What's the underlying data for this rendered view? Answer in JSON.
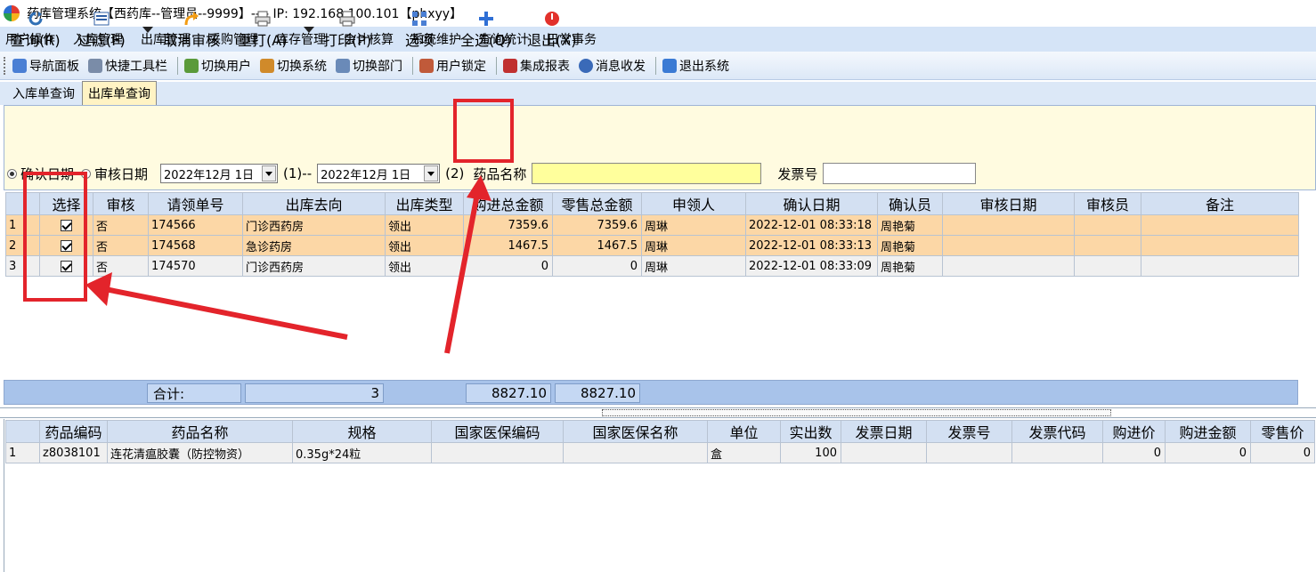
{
  "window": {
    "title": "药库管理系统【西药库--管理员--9999】---- IP: 192.168.100.101【phxyy】"
  },
  "menu": [
    "用户操作",
    "入库管理",
    "出库管理",
    "采购管理",
    "库存管理",
    "会计核算",
    "系统维护",
    "查询统计",
    "日常事务"
  ],
  "toolbar": [
    {
      "label": "导航面板",
      "icon": "navigation-panel-icon",
      "color": "#4a7fd4"
    },
    {
      "label": "快捷工具栏",
      "icon": "shortcut-toolbar-icon",
      "color": "#7a8ca8"
    },
    {
      "label": "切换用户",
      "icon": "switch-user-icon",
      "color": "#5a9a3a"
    },
    {
      "label": "切换系统",
      "icon": "switch-system-icon",
      "color": "#d08a2a"
    },
    {
      "label": "切换部门",
      "icon": "switch-department-icon",
      "color": "#6a8ab8"
    },
    {
      "label": "用户锁定",
      "icon": "user-lock-icon",
      "color": "#c05a3a"
    },
    {
      "label": "集成报表",
      "icon": "integrated-report-icon",
      "color": "#c03030"
    },
    {
      "label": "消息收发",
      "icon": "message-icon",
      "color": "#3a6ab8"
    },
    {
      "label": "退出系统",
      "icon": "exit-system-icon",
      "color": "#3a7ad4"
    }
  ],
  "tabs": [
    {
      "label": "入库单查询"
    },
    {
      "label": "出库单查询"
    }
  ],
  "actions": {
    "query": "查询(R)",
    "filter": "过滤(F)",
    "cancel_audit": "取消审核",
    "reprint": "重打(A)",
    "print": "打印(P)",
    "options": "选项",
    "select_all": "全选(Q)",
    "exit": "退出(X)"
  },
  "filter": {
    "confirm_date": "确认日期",
    "audit_date": "审核日期",
    "from_date": "2022年12月 1日",
    "label1": "(1)--",
    "to_date": "2022年12月 1日",
    "label2": "(2)",
    "drug_name_label": "药品名称",
    "drug_name_value": "",
    "invoice_label": "发票号",
    "invoice_value": ""
  },
  "main_table": {
    "columns": [
      "选择",
      "审核",
      "请领单号",
      "出库去向",
      "出库类型",
      "购进总金额",
      "零售总金额",
      "申领人",
      "确认日期",
      "确认员",
      "审核日期",
      "审核员",
      "备注"
    ],
    "rows": [
      {
        "index": "1",
        "selected": true,
        "audit": "否",
        "req_no": "174566",
        "dest": "门诊西药房",
        "type": "领出",
        "purchase": "7359.6",
        "retail": "7359.6",
        "applicant": "周琳",
        "confirm_date": "2022-12-01 08:33:18",
        "confirmer": "周艳菊",
        "audit_date": "",
        "auditor": "",
        "remark": ""
      },
      {
        "index": "2",
        "selected": true,
        "audit": "否",
        "req_no": "174568",
        "dest": "急诊药房",
        "type": "领出",
        "purchase": "1467.5",
        "retail": "1467.5",
        "applicant": "周琳",
        "confirm_date": "2022-12-01 08:33:13",
        "confirmer": "周艳菊",
        "audit_date": "",
        "auditor": "",
        "remark": ""
      },
      {
        "index": "3",
        "selected": true,
        "audit": "否",
        "req_no": "174570",
        "dest": "门诊西药房",
        "type": "领出",
        "purchase": "0",
        "retail": "0",
        "applicant": "周琳",
        "confirm_date": "2022-12-01 08:33:09",
        "confirmer": "周艳菊",
        "audit_date": "",
        "auditor": "",
        "remark": ""
      }
    ]
  },
  "summary": {
    "label": "合计:",
    "count": "3",
    "purchase_total": "8827.10",
    "retail_total": "8827.10"
  },
  "detail_table": {
    "columns": [
      "药品编码",
      "药品名称",
      "规格",
      "国家医保编码",
      "国家医保名称",
      "单位",
      "实出数",
      "发票日期",
      "发票号",
      "发票代码",
      "购进价",
      "购进金额",
      "零售价"
    ],
    "rows": [
      {
        "index": "1",
        "code": "z8038101",
        "name": "连花清瘟胶囊（防控物资）",
        "spec": "0.35g*24粒",
        "nhsa_code": "",
        "nhsa_name": "",
        "unit": "盒",
        "qty": "100",
        "inv_date": "",
        "inv_no": "",
        "inv_code": "",
        "price": "0",
        "amount": "0",
        "retail": "0"
      }
    ]
  }
}
